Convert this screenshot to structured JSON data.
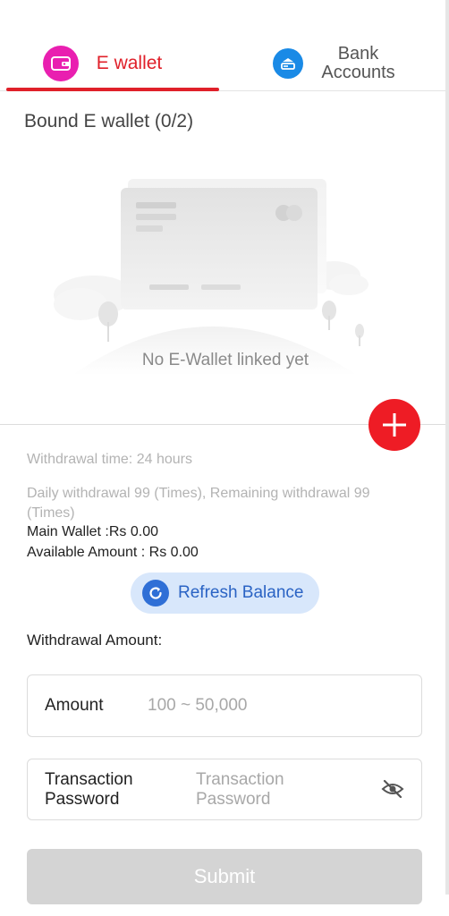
{
  "tabs": {
    "ewallet": {
      "label": "E wallet",
      "icon": "wallet-icon",
      "active": true
    },
    "bank": {
      "label_line1": "Bank",
      "label_line2": "Accounts",
      "icon": "bank-card-icon"
    }
  },
  "bound_title": "Bound E wallet (0/2)",
  "empty_state": {
    "text": "No E-Wallet linked yet"
  },
  "info": {
    "withdrawal_time": "Withdrawal time:   24 hours",
    "daily_withdrawal": "Daily withdrawal 99 (Times), Remaining withdrawal 99 (Times)",
    "main_wallet": "Main Wallet :Rs 0.00",
    "available_amount": "Available Amount : Rs 0.00"
  },
  "refresh": {
    "label": "Refresh Balance"
  },
  "withdrawal_amount_heading": "Withdrawal Amount:",
  "amount_field": {
    "label": "Amount",
    "placeholder": "100 ~ 50,000"
  },
  "password_field": {
    "label_line1": "Transaction",
    "label_line2": "Password",
    "placeholder_line1": "Transaction",
    "placeholder_line2": "Password"
  },
  "submit": {
    "label": "Submit"
  },
  "colors": {
    "accent_red": "#e0202a",
    "ewallet_icon_bg": "#e91fb0",
    "bank_icon_bg": "#1a8ae6",
    "refresh_bg": "#d8e7fb",
    "refresh_icon_bg": "#2f6fd6",
    "submit_disabled": "#d4d4d4"
  }
}
